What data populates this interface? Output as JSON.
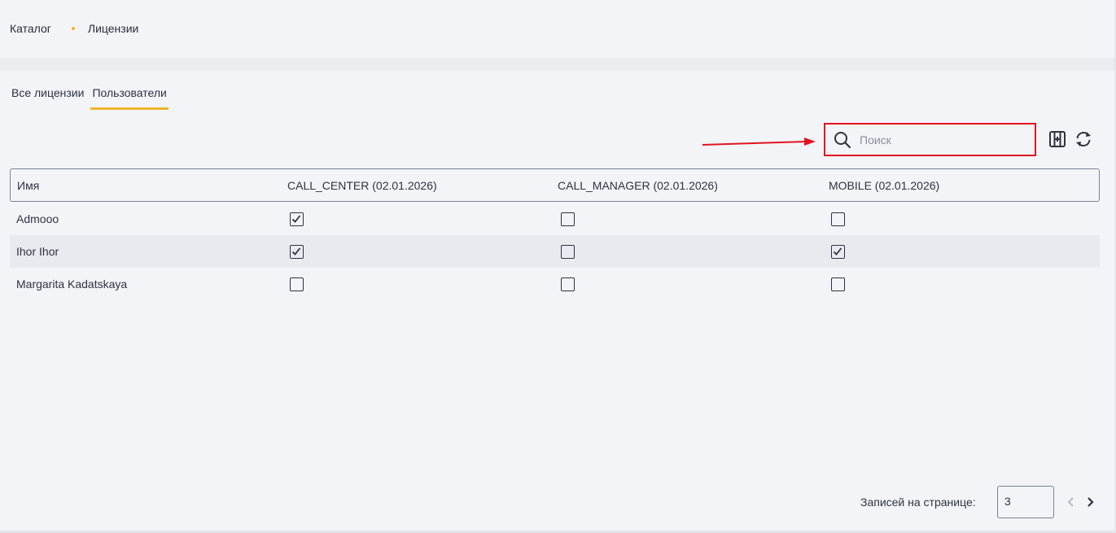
{
  "breadcrumb": {
    "root": "Каталог",
    "current": "Лицензии"
  },
  "tabs": [
    {
      "label": "Все лицензии",
      "active": false
    },
    {
      "label": "Пользователи",
      "active": true
    }
  ],
  "search": {
    "placeholder": "Поиск",
    "value": ""
  },
  "toolbar": {
    "icons": [
      "columns-settings-icon",
      "refresh-icon"
    ]
  },
  "table": {
    "columns": [
      "Имя",
      "CALL_CENTER (02.01.2026)",
      "CALL_MANAGER (02.01.2026)",
      "MOBILE (02.01.2026)"
    ],
    "rows": [
      {
        "name": "Admooo",
        "checks": [
          true,
          false,
          false
        ]
      },
      {
        "name": "Ihor Ihor",
        "checks": [
          true,
          false,
          true
        ]
      },
      {
        "name": "Margarita Kadatskaya",
        "checks": [
          false,
          false,
          false
        ]
      }
    ]
  },
  "pagination": {
    "label": "Записей на странице:",
    "page_size": "3"
  },
  "colors": {
    "accent": "#f0b429",
    "highlight": "#e0141e",
    "text": "#2e3240"
  }
}
